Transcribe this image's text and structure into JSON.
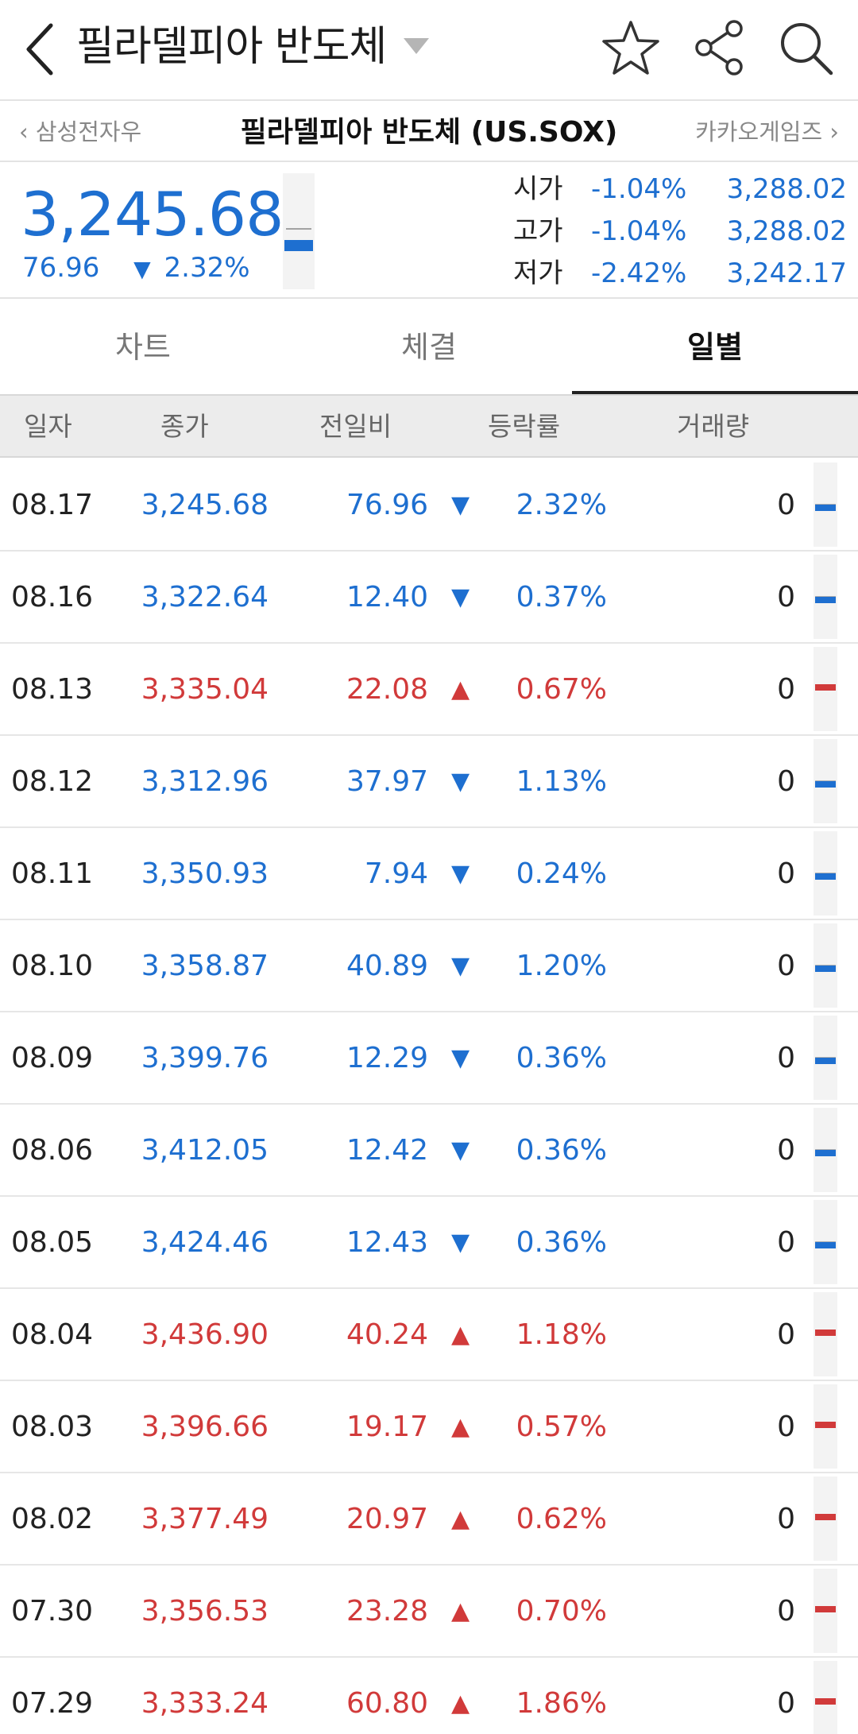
{
  "appbar": {
    "title": "필라델피아 반도체"
  },
  "subheader": {
    "prev": "삼성전자우",
    "symbol": "필라델피아 반도체 (US.SOX)",
    "next": "카카오게임즈"
  },
  "quote": {
    "price": "3,245.68",
    "change": "76.96",
    "change_pct": "2.32%",
    "direction": "down",
    "ohl": [
      {
        "label": "시가",
        "pct": "-1.04%",
        "value": "3,288.02"
      },
      {
        "label": "고가",
        "pct": "-1.04%",
        "value": "3,288.02"
      },
      {
        "label": "저가",
        "pct": "-2.42%",
        "value": "3,242.17"
      }
    ]
  },
  "tabs": [
    {
      "label": "차트",
      "active": false
    },
    {
      "label": "체결",
      "active": false
    },
    {
      "label": "일별",
      "active": true
    }
  ],
  "table": {
    "headers": [
      "일자",
      "종가",
      "전일비",
      "등락률",
      "거래량"
    ],
    "rows": [
      {
        "date": "08.17",
        "close": "3,245.68",
        "diff": "76.96",
        "dir": "down",
        "rate": "2.32%",
        "volume": "0"
      },
      {
        "date": "08.16",
        "close": "3,322.64",
        "diff": "12.40",
        "dir": "down",
        "rate": "0.37%",
        "volume": "0"
      },
      {
        "date": "08.13",
        "close": "3,335.04",
        "diff": "22.08",
        "dir": "up",
        "rate": "0.67%",
        "volume": "0"
      },
      {
        "date": "08.12",
        "close": "3,312.96",
        "diff": "37.97",
        "dir": "down",
        "rate": "1.13%",
        "volume": "0"
      },
      {
        "date": "08.11",
        "close": "3,350.93",
        "diff": "7.94",
        "dir": "down",
        "rate": "0.24%",
        "volume": "0"
      },
      {
        "date": "08.10",
        "close": "3,358.87",
        "diff": "40.89",
        "dir": "down",
        "rate": "1.20%",
        "volume": "0"
      },
      {
        "date": "08.09",
        "close": "3,399.76",
        "diff": "12.29",
        "dir": "down",
        "rate": "0.36%",
        "volume": "0"
      },
      {
        "date": "08.06",
        "close": "3,412.05",
        "diff": "12.42",
        "dir": "down",
        "rate": "0.36%",
        "volume": "0"
      },
      {
        "date": "08.05",
        "close": "3,424.46",
        "diff": "12.43",
        "dir": "down",
        "rate": "0.36%",
        "volume": "0"
      },
      {
        "date": "08.04",
        "close": "3,436.90",
        "diff": "40.24",
        "dir": "up",
        "rate": "1.18%",
        "volume": "0"
      },
      {
        "date": "08.03",
        "close": "3,396.66",
        "diff": "19.17",
        "dir": "up",
        "rate": "0.57%",
        "volume": "0"
      },
      {
        "date": "08.02",
        "close": "3,377.49",
        "diff": "20.97",
        "dir": "up",
        "rate": "0.62%",
        "volume": "0"
      },
      {
        "date": "07.30",
        "close": "3,356.53",
        "diff": "23.28",
        "dir": "up",
        "rate": "0.70%",
        "volume": "0"
      },
      {
        "date": "07.29",
        "close": "3,333.24",
        "diff": "60.80",
        "dir": "up",
        "rate": "1.86%",
        "volume": "0"
      }
    ]
  },
  "colors": {
    "up": "#d13a3a",
    "down": "#1e6fd0"
  },
  "icons": [
    "back-arrow-icon",
    "dropdown-caret-icon",
    "star-icon",
    "share-icon",
    "search-icon",
    "chevron-left-icon",
    "chevron-right-icon"
  ]
}
